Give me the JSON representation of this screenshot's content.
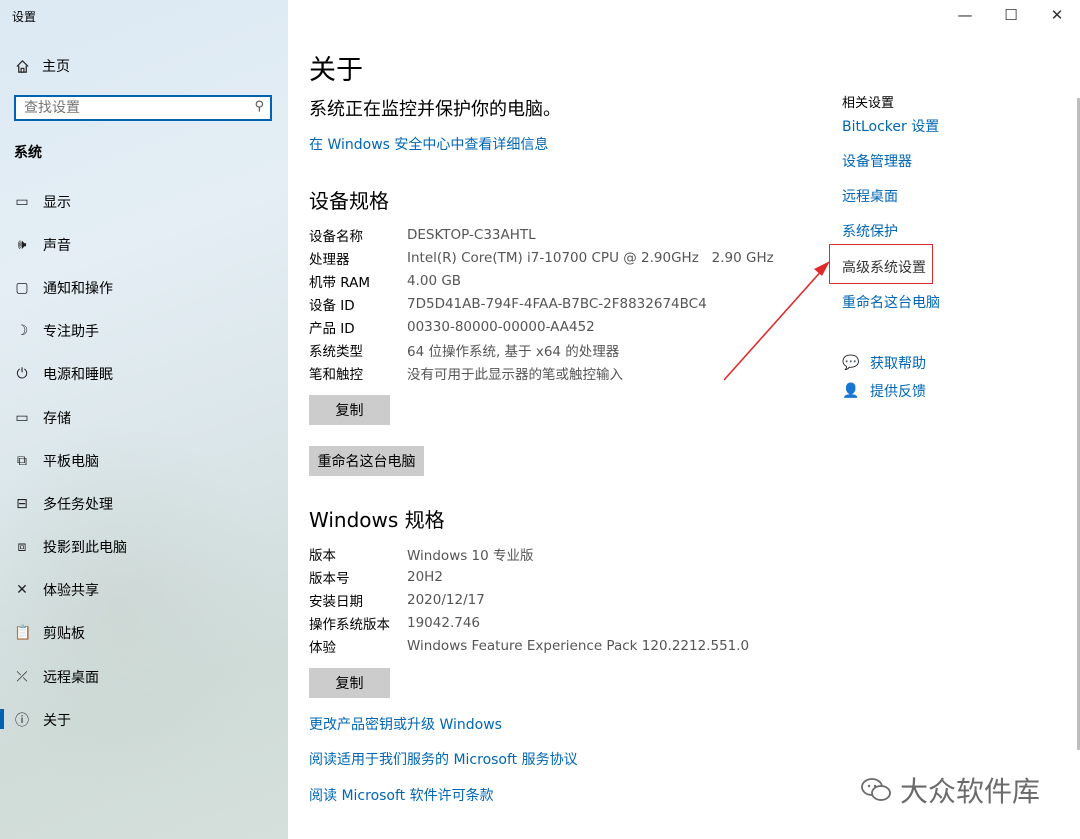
{
  "window": {
    "title": "设置",
    "controls": [
      "—",
      "☐",
      "✕"
    ]
  },
  "sidebar": {
    "home": "主页",
    "search_placeholder": "查找设置",
    "section": "系统",
    "items": [
      {
        "icon": "display-icon",
        "label": "显示"
      },
      {
        "icon": "sound-icon",
        "label": "声音"
      },
      {
        "icon": "notification-icon",
        "label": "通知和操作"
      },
      {
        "icon": "focus-assist-icon",
        "label": "专注助手"
      },
      {
        "icon": "power-icon",
        "label": "电源和睡眠"
      },
      {
        "icon": "storage-icon",
        "label": "存储"
      },
      {
        "icon": "tablet-icon",
        "label": "平板电脑"
      },
      {
        "icon": "multitasking-icon",
        "label": "多任务处理"
      },
      {
        "icon": "project-icon",
        "label": "投影到此电脑"
      },
      {
        "icon": "share-icon",
        "label": "体验共享"
      },
      {
        "icon": "clipboard-icon",
        "label": "剪贴板"
      },
      {
        "icon": "remote-desktop-icon",
        "label": "远程桌面"
      },
      {
        "icon": "info-icon",
        "label": "关于",
        "active": true
      }
    ]
  },
  "main": {
    "title": "关于",
    "status": "系统正在监控并保护你的电脑。",
    "security_link": "在 Windows 安全中心中查看详细信息",
    "device_specs": {
      "heading": "设备规格",
      "rows": [
        {
          "key": "设备名称",
          "value": "DESKTOP-C33AHTL"
        },
        {
          "key": "处理器",
          "value": "Intel(R) Core(TM) i7-10700 CPU @ 2.90GHz   2.90 GHz"
        },
        {
          "key": "机带 RAM",
          "value": "4.00 GB"
        },
        {
          "key": "设备 ID",
          "value": "7D5D41AB-794F-4FAA-B7BC-2F8832674BC4"
        },
        {
          "key": "产品 ID",
          "value": "00330-80000-00000-AA452"
        },
        {
          "key": "系统类型",
          "value": "64 位操作系统, 基于 x64 的处理器"
        },
        {
          "key": "笔和触控",
          "value": "没有可用于此显示器的笔或触控输入"
        }
      ],
      "copy_button": "复制",
      "rename_button": "重命名这台电脑"
    },
    "windows_specs": {
      "heading": "Windows 规格",
      "rows": [
        {
          "key": "版本",
          "value": "Windows 10 专业版"
        },
        {
          "key": "版本号",
          "value": "20H2"
        },
        {
          "key": "安装日期",
          "value": "2020/12/17"
        },
        {
          "key": "操作系统版本",
          "value": "19042.746"
        },
        {
          "key": "体验",
          "value": "Windows Feature Experience Pack 120.2212.551.0"
        }
      ],
      "copy_button": "复制"
    },
    "bottom_links": [
      "更改产品密钥或升级 Windows",
      "阅读适用于我们服务的 Microsoft 服务协议",
      "阅读 Microsoft 软件许可条款"
    ]
  },
  "related": {
    "title": "相关设置",
    "links": [
      {
        "label": "BitLocker 设置"
      },
      {
        "label": "设备管理器"
      },
      {
        "label": "远程桌面"
      },
      {
        "label": "系统保护"
      },
      {
        "label": "高级系统设置",
        "highlighted": true
      },
      {
        "label": "重命名这台电脑"
      }
    ],
    "help": [
      {
        "icon": "get-help-icon",
        "label": "获取帮助"
      },
      {
        "icon": "feedback-icon",
        "label": "提供反馈"
      }
    ]
  },
  "annotation": {
    "color": "#e02a2a"
  },
  "watermark": {
    "text": "大众软件库"
  },
  "colors": {
    "accent": "#0066b4",
    "highlight": "#e02a2a"
  }
}
